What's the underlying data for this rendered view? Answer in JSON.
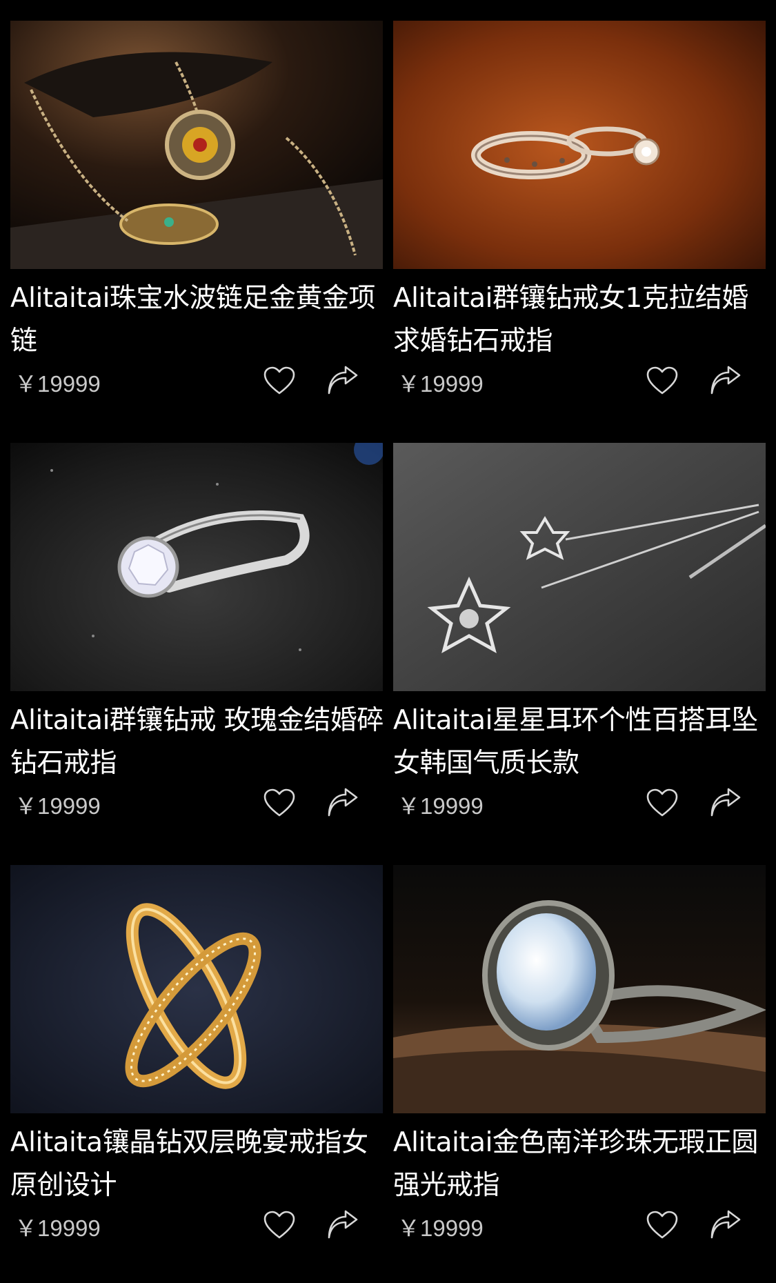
{
  "products": [
    {
      "title": "Alitaitai珠宝水波链足金黄金项链",
      "price": "￥19999",
      "image_icon": "gold-necklace-photo",
      "accent": "#b07a2a"
    },
    {
      "title": "Alitaitai群镶钻戒女1克拉结婚求婚钻石戒指",
      "price": "￥19999",
      "image_icon": "silver-rings-photo",
      "accent": "#8a3a12"
    },
    {
      "title": "Alitaitai群镶钻戒 玫瑰金结婚碎钻石戒指",
      "price": "￥19999",
      "image_icon": "diamond-ring-photo",
      "accent": "#2a2a2a"
    },
    {
      "title": "Alitaitai星星耳环个性百搭耳坠女韩国气质长款",
      "price": "￥19999",
      "image_icon": "star-earrings-photo",
      "accent": "#4a4a4a"
    },
    {
      "title": "Alitaita镶晶钻双层晚宴戒指女原创设计",
      "price": "￥19999",
      "image_icon": "gold-crossed-rings-photo",
      "accent": "#1c2436"
    },
    {
      "title": "Alitaitai金色南洋珍珠无瑕正圆强光戒指",
      "price": "￥19999",
      "image_icon": "moonstone-ring-photo",
      "accent": "#6a4a30"
    }
  ],
  "colors": {
    "background": "#000000",
    "title_text": "#ffffff",
    "price_text": "#c9c9c9",
    "icon_stroke": "#d8d8d8"
  }
}
